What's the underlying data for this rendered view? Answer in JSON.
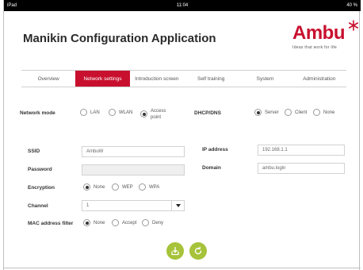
{
  "status_bar": {
    "left": "iPad",
    "center": "11:04",
    "right": "40 %"
  },
  "app": {
    "title": "Manikin Configuration Application"
  },
  "logo": {
    "word": "Ambu",
    "tagline": "Ideas that work for life",
    "color": "#c8102e"
  },
  "tabs": [
    {
      "label": "Overview",
      "active": false
    },
    {
      "label": "Network settings",
      "active": true
    },
    {
      "label": "Introduction screen",
      "active": false
    },
    {
      "label": "Self training",
      "active": false
    },
    {
      "label": "System",
      "active": false
    },
    {
      "label": "Administration",
      "active": false
    }
  ],
  "network_mode": {
    "label": "Network mode",
    "options": [
      {
        "label": "LAN",
        "checked": false
      },
      {
        "label": "WLAN",
        "checked": false
      },
      {
        "label": "Access point",
        "checked": true
      }
    ]
  },
  "dhcp": {
    "label": "DHCP/DNS",
    "options": [
      {
        "label": "Server",
        "checked": true
      },
      {
        "label": "Client",
        "checked": false
      },
      {
        "label": "None",
        "checked": false
      }
    ]
  },
  "ssid": {
    "label": "SSID",
    "value": "AmbuW"
  },
  "password": {
    "label": "Password",
    "value": ""
  },
  "encryption": {
    "label": "Encryption",
    "options": [
      {
        "label": "None",
        "checked": true
      },
      {
        "label": "WEP",
        "checked": false
      },
      {
        "label": "WPA",
        "checked": false
      }
    ]
  },
  "channel": {
    "label": "Channel",
    "value": "1"
  },
  "mac_filter": {
    "label": "MAC address filter",
    "options": [
      {
        "label": "None",
        "checked": true
      },
      {
        "label": "Accept",
        "checked": false
      },
      {
        "label": "Deny",
        "checked": false
      }
    ]
  },
  "ip_address": {
    "label": "IP address",
    "value": "192.168.1.1"
  },
  "domain": {
    "label": "Domain",
    "value": "ambu.login"
  },
  "actions": {
    "save_icon": "save-tray-icon",
    "refresh_icon": "refresh-icon",
    "button_color": "#a6c33a"
  }
}
